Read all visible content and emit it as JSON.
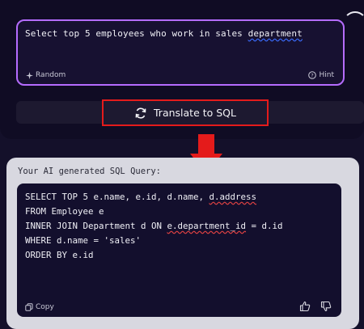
{
  "prompt": {
    "text_before": "Select top 5 employees who work in sales ",
    "text_underlined": "department",
    "random_label": "Random",
    "hint_label": "Hint"
  },
  "translate": {
    "label": "Translate to SQL"
  },
  "result": {
    "label": "Your AI generated SQL Query:",
    "sql": {
      "l1_a": "SELECT TOP 5 e.name, e.id, d.name, ",
      "l1_b": "d.address",
      "l2": "FROM Employee e",
      "l3_a": "INNER JOIN Department d ON ",
      "l3_b": "e.department_id",
      "l3_c": " = d.id",
      "l4": "WHERE d.name = 'sales'",
      "l5": "ORDER BY e.id"
    },
    "copy_label": "Copy"
  },
  "colors": {
    "prompt_border": "#b56cff",
    "highlight_red": "#e41b1b",
    "card_bg": "#d8d8e0",
    "sql_bg": "#130f2d"
  }
}
